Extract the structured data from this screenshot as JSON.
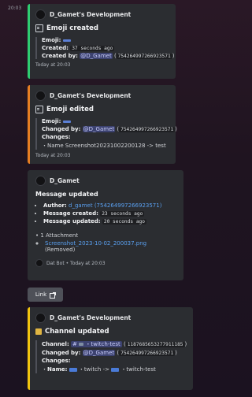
{
  "time_left": "20:03",
  "embeds": [
    {
      "author": "D_Gamet's Development",
      "title": "Emoji created",
      "emoji_label": "Emoji:",
      "created_label": "Created:",
      "created_value": "37 seconds ago",
      "created_by_label": "Created by:",
      "created_by_mention": "@D_Gamet",
      "created_by_id": "754264997266923571",
      "footer": "Today at 20:03",
      "bar_color": "#2ecc71"
    },
    {
      "author": "D_Gamet's Development",
      "title": "Emoji edited",
      "emoji_label": "Emoji:",
      "changed_by_label": "Changed by:",
      "changed_by_mention": "@D_Gamet",
      "changed_by_id": "754264997266923571",
      "changes_label": "Changes:",
      "change_line": "・Name Screenshot20231002200128 -> test",
      "footer": "Today at 20:03",
      "bar_color": "#e67e22"
    },
    {
      "author": "D_Gamet",
      "title": "Message updated",
      "author_label": "Author:",
      "author_name": "d_gamet",
      "author_id": "754264997266923571",
      "created_label": "Message created:",
      "created_value": "23 seconds ago",
      "updated_label": "Message updated:",
      "updated_value": "20 seconds ago",
      "attachments_line": "1 Attachment",
      "attachment_name": "Screenshot_2023-10-02_200037.png",
      "attachment_status": "(Removed)",
      "footer": "Dat Bot • Today at 20:03",
      "bar_color": "#2b2d31"
    },
    {
      "author": "D_Gamet's Development",
      "title": "Channel updated",
      "channel_label": "Channel:",
      "channel_hash": "#",
      "channel_name": "・twitch-test",
      "channel_id": "1187685653277911185",
      "changed_by_label": "Changed by:",
      "changed_by_mention": "@D_Gamet",
      "changed_by_id": "754264997266923571",
      "changes_label": "Changes:",
      "name_label": "Name:",
      "name_from": "・twitch ->",
      "name_to": "・twitch-test",
      "bar_color": "#f1c40f"
    }
  ],
  "link_button": {
    "label": "Link"
  }
}
